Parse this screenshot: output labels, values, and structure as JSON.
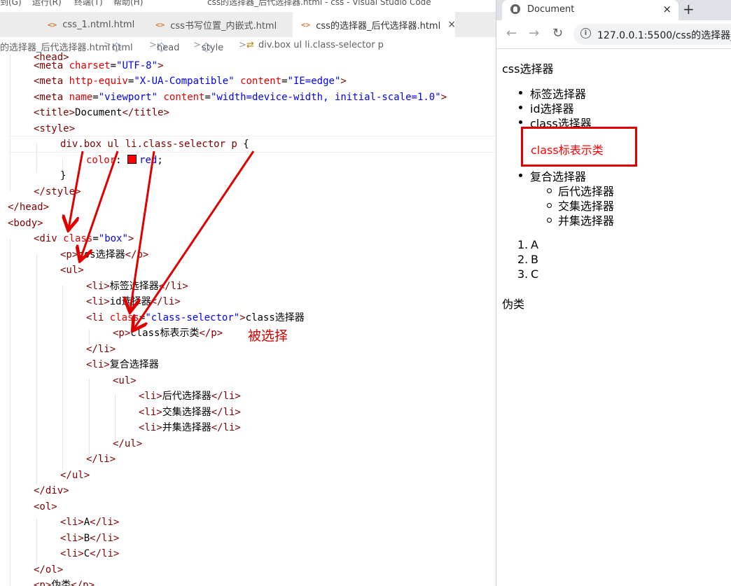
{
  "vscode": {
    "window_title": "css的选择器_后代选择器.html - css - Visual Studio Code",
    "menu": [
      "到(G)",
      "运行(R)",
      "终端(T)",
      "帮助(H)"
    ],
    "tabs": [
      {
        "label": "css_1.ntml.html",
        "active": false
      },
      {
        "label": "css书写位置_内嵌式.html",
        "active": false
      },
      {
        "label": "css的选择器_后代选择器.html",
        "active": true
      }
    ],
    "tab_icon": "<>",
    "tab_close": "×",
    "breadcrumb": [
      "的选择器_后代选择器.html",
      "html",
      "head",
      "style",
      "div.box ul li.class-selector p"
    ],
    "breadcrumb_sep": ">",
    "annotation": "被选择",
    "code": {
      "meta_charset": "UTF-8",
      "meta_http_equiv": "X-UA-Compatible",
      "meta_content_ie": "IE=edge",
      "meta_viewport_name": "viewport",
      "meta_viewport_content": "width=device-width, initial-scale=1.0",
      "title": "Document",
      "selector": "div.box ul li.class-selector p",
      "property": "color",
      "value": "red",
      "div_class": "box",
      "p_css": "css选择器",
      "li_tag": "标签选择器",
      "li_id": "id选择器",
      "li_class_attr": "class-selector",
      "li_class_text": "class选择器",
      "p_class": "class标表示类",
      "li_compound": "复合选择器",
      "li_desc": "后代选择器",
      "li_inter": "交集选择器",
      "li_union": "并集选择器",
      "ol_a": "A",
      "ol_b": "B",
      "ol_c": "C",
      "p_pseudo": "伪类"
    }
  },
  "browser": {
    "tab_title": "Document",
    "tab_close": "×",
    "new_tab": "+",
    "url": "127.0.0.1:5500/css的选择器_后",
    "page": {
      "heading_p": "css选择器",
      "ul_items": [
        "标签选择器",
        "id选择器",
        "class选择器"
      ],
      "class_p": "class标表示类",
      "compound": "复合选择器",
      "sub_items": [
        "后代选择器",
        "交集选择器",
        "并集选择器"
      ],
      "ol_items": [
        "A",
        "B",
        "C"
      ],
      "pseudo_p": "伪类"
    }
  },
  "colors": {
    "highlight_red": "#ff0000",
    "arrow_red": "#e00000"
  }
}
